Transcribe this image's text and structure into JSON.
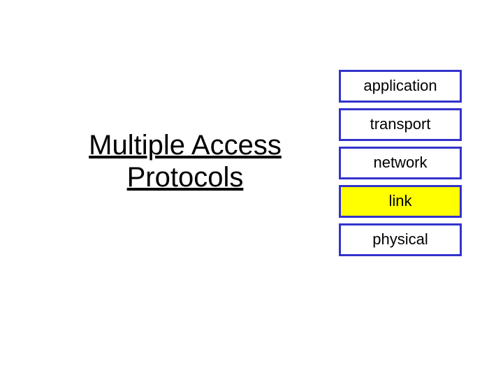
{
  "title": "Multiple Access Protocols",
  "layers": {
    "l0": "application",
    "l1": "transport",
    "l2": "network",
    "l3": "link",
    "l4": "physical"
  },
  "highlight_layer": "link",
  "colors": {
    "border": "#3333cc",
    "highlight_bg": "#ffff00"
  }
}
